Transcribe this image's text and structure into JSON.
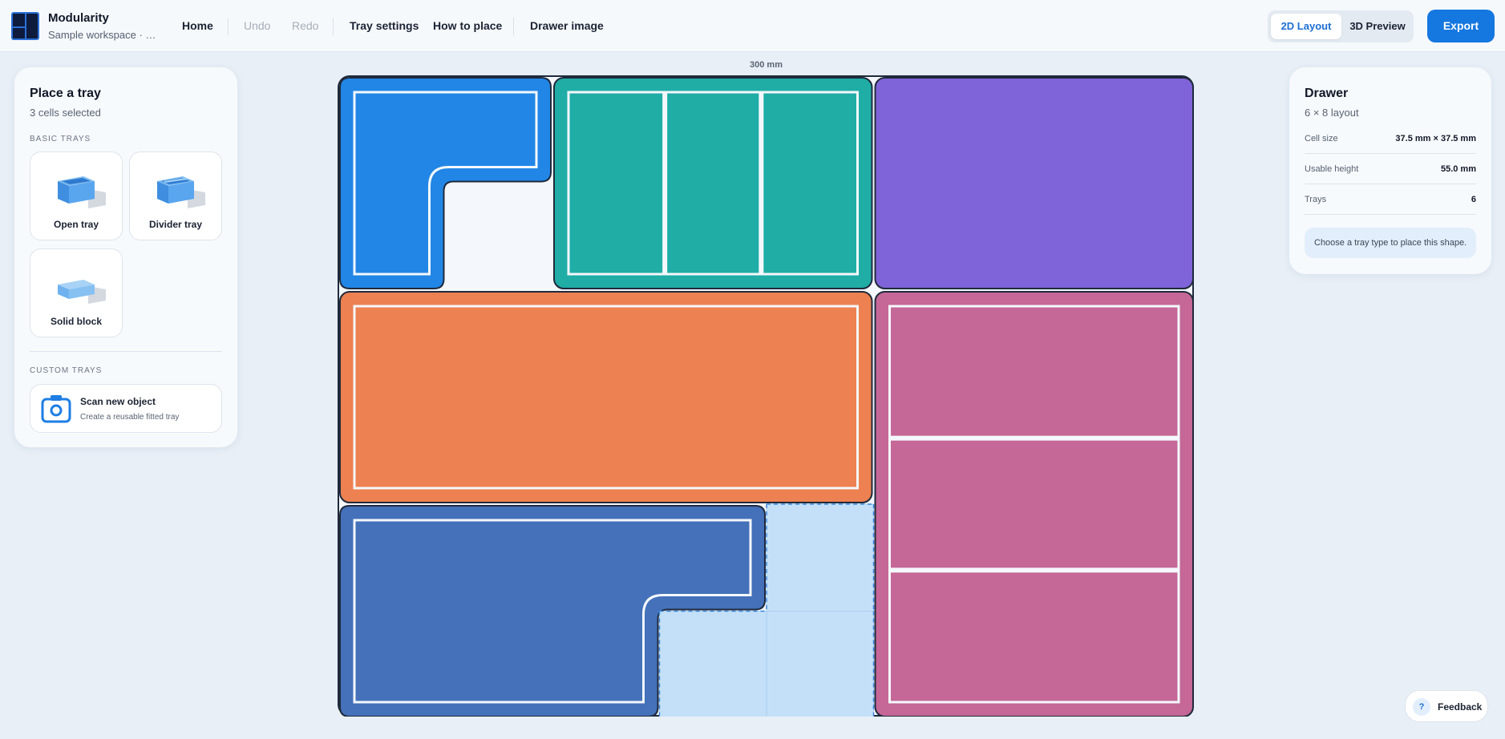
{
  "app": {
    "title": "Modularity",
    "workspace": "Sample workspace · Sa..."
  },
  "nav": {
    "home": "Home",
    "undo": "Undo",
    "redo": "Redo",
    "tray_settings": "Tray settings",
    "how_to_place": "How to place",
    "drawer_image": "Drawer image"
  },
  "view_toggle": {
    "layout_2d": "2D Layout",
    "preview_3d": "3D Preview",
    "active": "2D Layout"
  },
  "export_label": "Export",
  "place_panel": {
    "title": "Place a tray",
    "subtitle": "3 cells selected",
    "basic_header": "BASIC TRAYS",
    "basic_trays": [
      {
        "label": "Open tray",
        "icon": "open-tray-icon"
      },
      {
        "label": "Divider tray",
        "icon": "divider-tray-icon"
      },
      {
        "label": "Solid block",
        "icon": "solid-block-icon"
      }
    ],
    "custom_header": "CUSTOM TRAYS",
    "scan": {
      "title": "Scan new object",
      "subtitle": "Create a reusable fitted tray",
      "icon": "camera-icon"
    }
  },
  "drawer_panel": {
    "title": "Drawer",
    "subtitle": "6 × 8 layout",
    "rows": [
      {
        "key": "Cell size",
        "value": "37.5 mm × 37.5 mm"
      },
      {
        "key": "Usable height",
        "value": "55.0 mm"
      },
      {
        "key": "Trays",
        "value": "6"
      }
    ],
    "hint": "Choose a tray type to place this shape."
  },
  "drawer_width_label": "300 mm",
  "feedback_label": "Feedback",
  "colors": {
    "accent": "#1577e0",
    "tray_blue": "#2186e6",
    "tray_teal": "#1fada6",
    "tray_purple": "#7f63d8",
    "tray_orange": "#ed8151",
    "tray_pink": "#c56797",
    "tray_navy": "#4471b9",
    "selection": "#c4e0f8"
  },
  "layout_grid": {
    "columns": 8,
    "rows": 6,
    "trays": [
      {
        "name": "L-shaped open tray",
        "color": "tray_blue",
        "type": "open",
        "cells": [
          [
            0,
            0
          ],
          [
            1,
            0
          ],
          [
            0,
            1
          ]
        ]
      },
      {
        "name": "Divider tray",
        "color": "tray_teal",
        "type": "divider",
        "cells": [
          [
            2,
            0
          ],
          [
            3,
            0
          ],
          [
            4,
            0
          ],
          [
            2,
            1
          ],
          [
            3,
            1
          ],
          [
            4,
            1
          ]
        ]
      },
      {
        "name": "Solid block",
        "color": "tray_purple",
        "type": "solid",
        "cells": [
          [
            5,
            0
          ],
          [
            6,
            0
          ],
          [
            7,
            0
          ],
          [
            5,
            1
          ],
          [
            6,
            1
          ],
          [
            7,
            1
          ]
        ]
      },
      {
        "name": "Open tray",
        "color": "tray_orange",
        "type": "open",
        "cells": [
          [
            0,
            2
          ],
          [
            1,
            2
          ],
          [
            2,
            2
          ],
          [
            3,
            2
          ],
          [
            4,
            2
          ],
          [
            0,
            3
          ],
          [
            1,
            3
          ],
          [
            2,
            3
          ],
          [
            3,
            3
          ],
          [
            4,
            3
          ]
        ]
      },
      {
        "name": "Divider tray",
        "color": "tray_pink",
        "type": "divider",
        "cells": [
          [
            5,
            2
          ],
          [
            6,
            2
          ],
          [
            7,
            2
          ],
          [
            5,
            3
          ],
          [
            6,
            3
          ],
          [
            7,
            3
          ],
          [
            5,
            4
          ],
          [
            6,
            4
          ],
          [
            7,
            4
          ],
          [
            5,
            5
          ],
          [
            6,
            5
          ],
          [
            7,
            5
          ]
        ]
      },
      {
        "name": "L-shaped open tray",
        "color": "tray_navy",
        "type": "open",
        "cells": [
          [
            0,
            4
          ],
          [
            1,
            4
          ],
          [
            2,
            4
          ],
          [
            3,
            4
          ],
          [
            0,
            5
          ],
          [
            1,
            5
          ],
          [
            2,
            5
          ]
        ]
      }
    ],
    "selected_cells": [
      [
        4,
        4
      ],
      [
        3,
        5
      ],
      [
        4,
        5
      ]
    ]
  }
}
